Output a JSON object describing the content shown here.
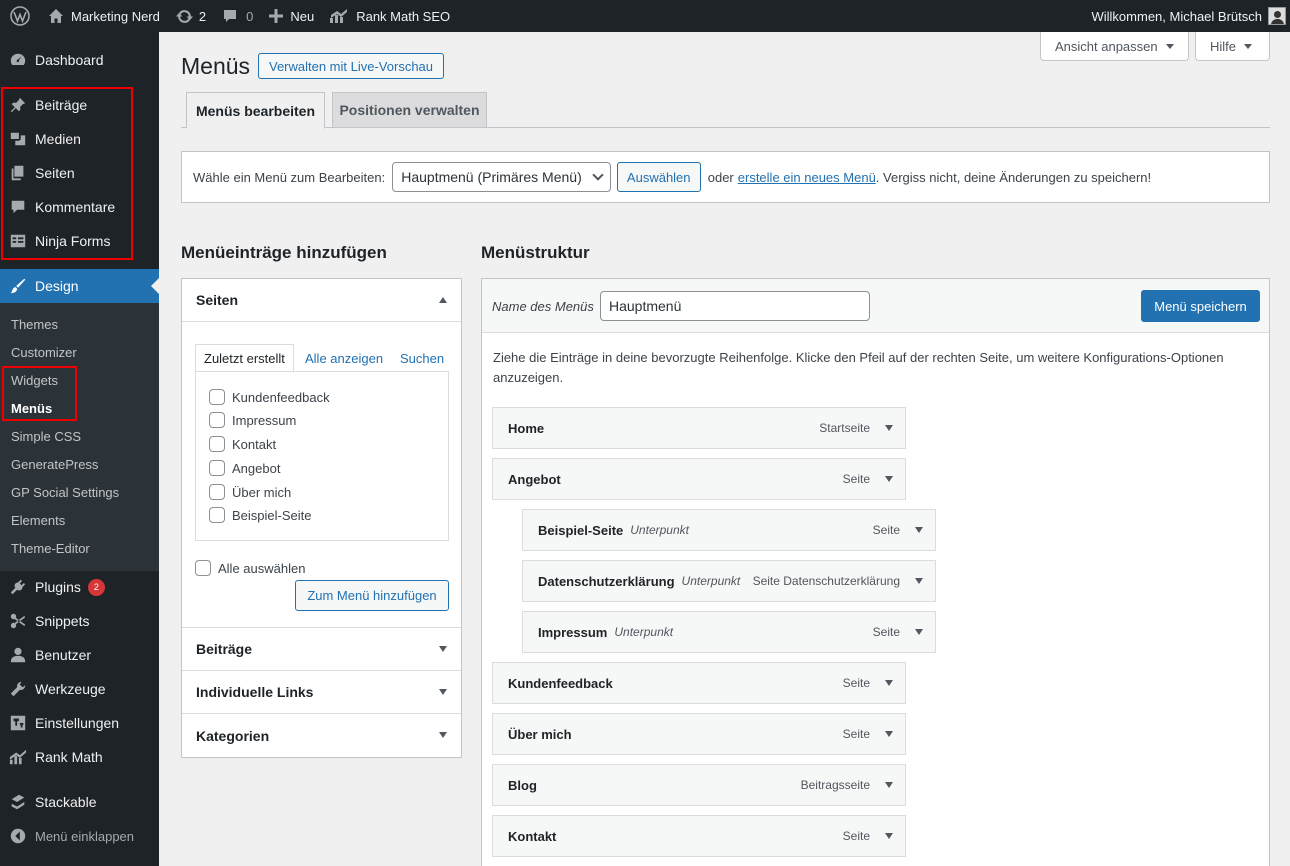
{
  "admin_bar": {
    "site_name": "Marketing Nerd",
    "updates_count": "2",
    "comments_count": "0",
    "new_label": "Neu",
    "rank_math_label": "Rank Math SEO",
    "greeting": "Willkommen, Michael Brütsch"
  },
  "sidebar": {
    "items": [
      {
        "label": "Dashboard",
        "icon": "dashboard-icon"
      },
      {
        "label": "Beiträge",
        "icon": "pin-icon"
      },
      {
        "label": "Medien",
        "icon": "media-icon"
      },
      {
        "label": "Seiten",
        "icon": "pages-icon"
      },
      {
        "label": "Kommentare",
        "icon": "comment-icon"
      },
      {
        "label": "Ninja Forms",
        "icon": "forms-icon"
      },
      {
        "label": "Design",
        "icon": "brush-icon"
      },
      {
        "label": "Plugins",
        "icon": "plugin-icon",
        "badge": "2"
      },
      {
        "label": "Snippets",
        "icon": "scissors-icon"
      },
      {
        "label": "Benutzer",
        "icon": "user-icon"
      },
      {
        "label": "Werkzeuge",
        "icon": "wrench-icon"
      },
      {
        "label": "Einstellungen",
        "icon": "settings-icon"
      },
      {
        "label": "Rank Math",
        "icon": "chart-icon"
      },
      {
        "label": "Stackable",
        "icon": "stackable-icon"
      },
      {
        "label": "Menü einklappen",
        "icon": "collapse-icon"
      }
    ],
    "design_submenu": [
      "Themes",
      "Customizer",
      "Widgets",
      "Menüs",
      "Simple CSS",
      "GeneratePress",
      "GP Social Settings",
      "Elements",
      "Theme-Editor"
    ]
  },
  "screen_options": {
    "label": "Ansicht anpassen",
    "help": "Hilfe"
  },
  "page": {
    "title": "Menüs",
    "live_preview": "Verwalten mit Live-Vorschau",
    "tabs": [
      "Menüs bearbeiten",
      "Positionen verwalten"
    ]
  },
  "select_menu": {
    "label": "Wähle ein Menü zum Bearbeiten:",
    "value": "Hauptmenü (Primäres Menü)",
    "button": "Auswählen",
    "text_before": "oder",
    "link": "erstelle ein neues Menü",
    "text_after": ". Vergiss nicht, deine Änderungen zu speichern!"
  },
  "add_items": {
    "heading": "Menüeinträge hinzufügen",
    "pages_title": "Seiten",
    "tabs": [
      "Zuletzt erstellt",
      "Alle anzeigen",
      "Suchen"
    ],
    "pages": [
      "Kundenfeedback",
      "Impressum",
      "Kontakt",
      "Angebot",
      "Über mich",
      "Beispiel-Seite"
    ],
    "select_all": "Alle auswählen",
    "add_button": "Zum Menü hinzufügen",
    "sections": [
      "Beiträge",
      "Individuelle Links",
      "Kategorien"
    ]
  },
  "structure": {
    "heading": "Menüstruktur",
    "name_label": "Name des Menüs",
    "name_value": "Hauptmenü",
    "save_button": "Menü speichern",
    "instructions": "Ziehe die Einträge in deine bevorzugte Reihenfolge. Klicke den Pfeil auf der rechten Seite, um weitere Konfigurations-Optionen anzuzeigen.",
    "items": [
      {
        "title": "Home",
        "sub": "",
        "type": "Startseite",
        "depth": 0
      },
      {
        "title": "Angebot",
        "sub": "",
        "type": "Seite",
        "depth": 0
      },
      {
        "title": "Beispiel-Seite",
        "sub": "Unterpunkt",
        "type": "Seite",
        "depth": 1
      },
      {
        "title": "Datenschutzerklärung",
        "sub": "Unterpunkt",
        "type": "Seite Datenschutzerklärung",
        "depth": 1
      },
      {
        "title": "Impressum",
        "sub": "Unterpunkt",
        "type": "Seite",
        "depth": 1
      },
      {
        "title": "Kundenfeedback",
        "sub": "",
        "type": "Seite",
        "depth": 0
      },
      {
        "title": "Über mich",
        "sub": "",
        "type": "Seite",
        "depth": 0
      },
      {
        "title": "Blog",
        "sub": "",
        "type": "Beitragsseite",
        "depth": 0
      },
      {
        "title": "Kontakt",
        "sub": "",
        "type": "Seite",
        "depth": 0
      }
    ]
  }
}
